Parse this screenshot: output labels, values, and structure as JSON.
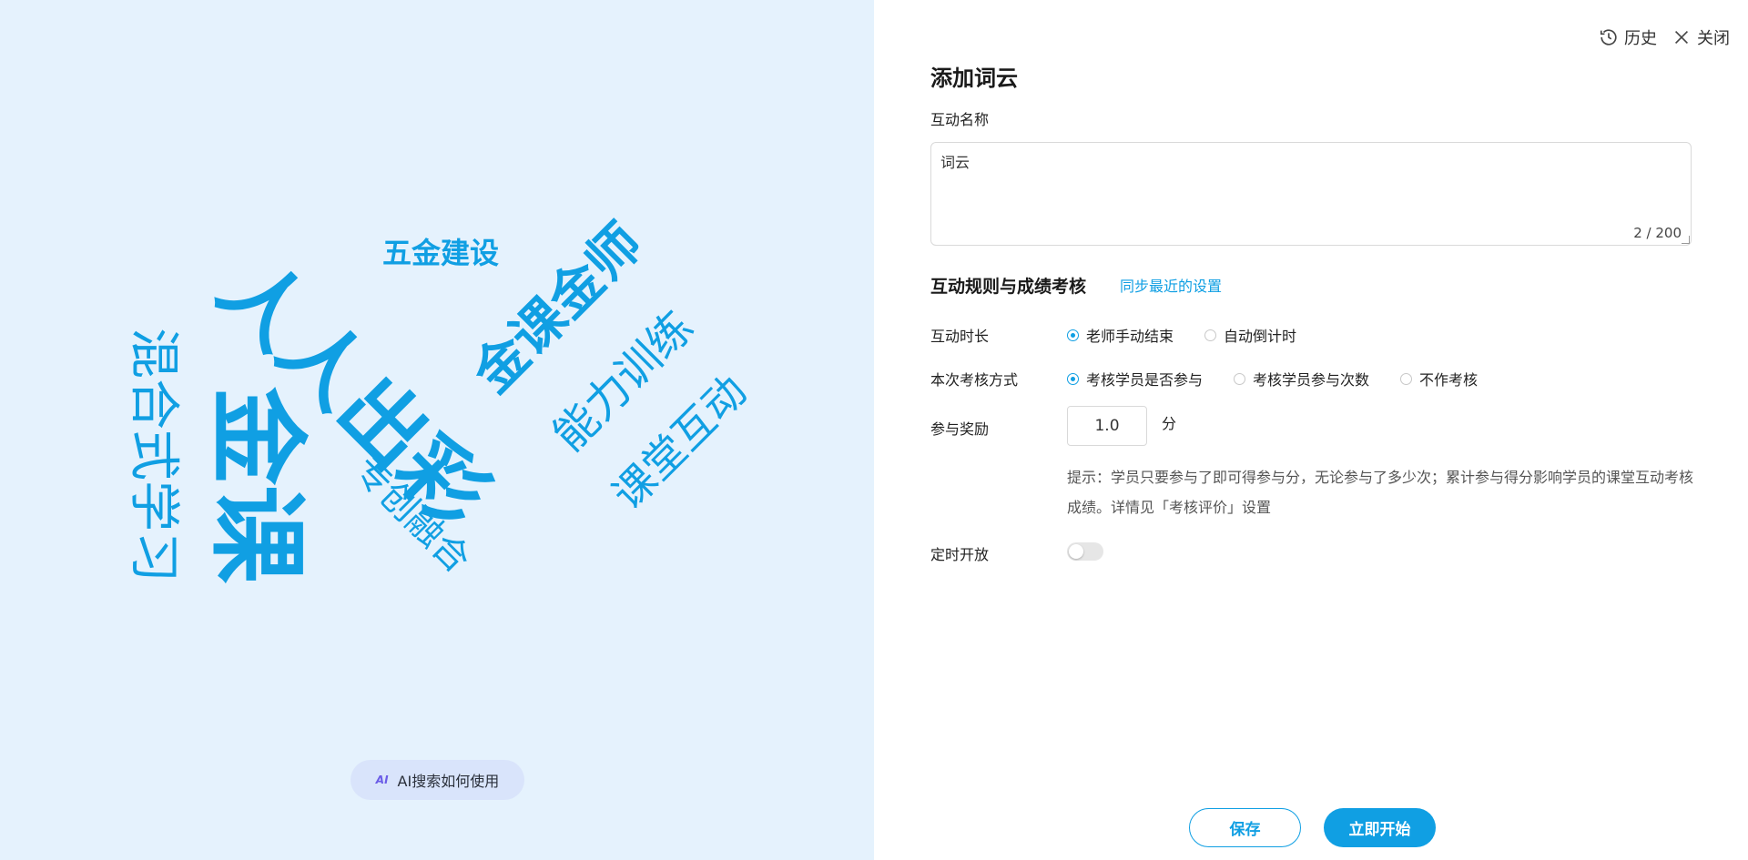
{
  "preview": {
    "words": [
      {
        "text": "五金建设"
      },
      {
        "text": "金课金师"
      },
      {
        "text": "人人出彩"
      },
      {
        "text": "能力训练"
      },
      {
        "text": "课堂互动"
      },
      {
        "text": "专创融合"
      },
      {
        "text": "金课"
      },
      {
        "text": "混合式学习"
      }
    ],
    "ai_button": {
      "icon": "AI",
      "label": "AI搜索如何使用"
    }
  },
  "header": {
    "history_label": "历史",
    "close_label": "关闭"
  },
  "form": {
    "title": "添加词云",
    "name_label": "互动名称",
    "name_value": "词云",
    "name_counter": "2 / 200",
    "rules_title": "互动规则与成绩考核",
    "sync_link": "同步最近的设置",
    "duration": {
      "label": "互动时长",
      "options": [
        {
          "label": "老师手动结束",
          "selected": true
        },
        {
          "label": "自动倒计时",
          "selected": false
        }
      ]
    },
    "assessment": {
      "label": "本次考核方式",
      "options": [
        {
          "label": "考核学员是否参与",
          "selected": true
        },
        {
          "label": "考核学员参与次数",
          "selected": false
        },
        {
          "label": "不作考核",
          "selected": false
        }
      ]
    },
    "reward": {
      "label": "参与奖励",
      "value": "1.0",
      "unit": "分"
    },
    "hint": "提示：学员只要参与了即可得参与分，无论参与了多少次；累计参与得分影响学员的课堂互动考核成绩。详情见「考核评价」设置",
    "timer": {
      "label": "定时开放",
      "enabled": false
    }
  },
  "footer": {
    "save_label": "保存",
    "start_label": "立即开始"
  },
  "colors": {
    "accent": "#109fe3",
    "preview_bg": "#e5f2fd"
  }
}
